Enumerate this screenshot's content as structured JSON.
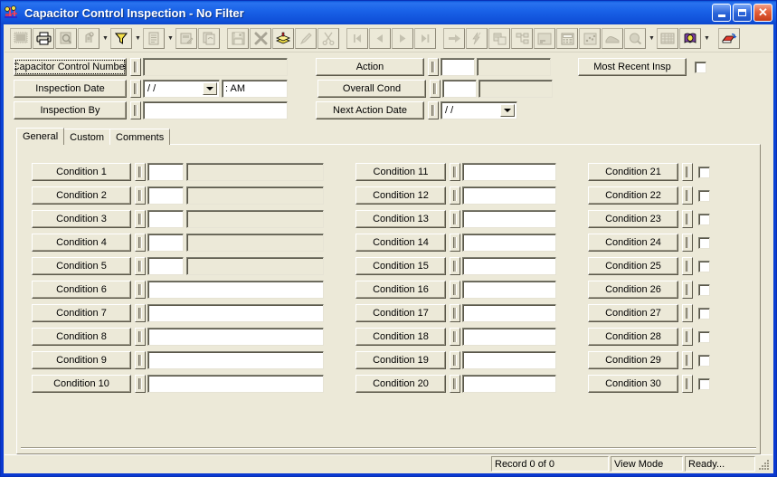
{
  "window": {
    "title": "Capacitor Control Inspection",
    "title_suffix": " - No Filter",
    "icon": "capacitor-app-icon",
    "minimize_label": "Minimize",
    "maximize_label": "Maximize",
    "close_label": "Close"
  },
  "toolbar": {
    "buttons": [
      {
        "name": "design-view-icon",
        "label": "Design View",
        "enabled": false
      },
      {
        "name": "print-icon",
        "label": "Print",
        "enabled": true
      },
      {
        "name": "print-preview-icon",
        "label": "Print Preview",
        "enabled": false
      },
      {
        "name": "find-icon",
        "label": "Find",
        "enabled": false,
        "dropdown": true
      },
      {
        "name": "filter-icon",
        "label": "Filter",
        "enabled": true,
        "dropdown": true
      },
      {
        "name": "new-record-icon",
        "label": "New Record",
        "enabled": false,
        "dropdown": true
      },
      {
        "name": "edit-record-icon",
        "label": "Edit Record",
        "enabled": false
      },
      {
        "name": "duplicate-record-icon",
        "label": "Duplicate Record",
        "enabled": false
      },
      {
        "name": "save-icon",
        "label": "Save",
        "enabled": false
      },
      {
        "name": "delete-icon",
        "label": "Delete",
        "enabled": true
      },
      {
        "name": "stack-icon",
        "label": "Batch",
        "enabled": true
      },
      {
        "name": "pencil-icon",
        "label": "Edit",
        "enabled": false
      },
      {
        "name": "cut-icon",
        "label": "Cut",
        "enabled": false
      },
      {
        "name": "first-record-icon",
        "label": "First Record",
        "enabled": false
      },
      {
        "name": "previous-record-icon",
        "label": "Previous Record",
        "enabled": false
      },
      {
        "name": "next-record-icon",
        "label": "Next Record",
        "enabled": false
      },
      {
        "name": "last-record-icon",
        "label": "Last Record",
        "enabled": false
      },
      {
        "name": "go-to-icon",
        "label": "Go To",
        "enabled": false
      },
      {
        "name": "lightning-icon",
        "label": "Quick Action",
        "enabled": false
      },
      {
        "name": "related-records-icon",
        "label": "Related Records",
        "enabled": false
      },
      {
        "name": "hierarchy-icon",
        "label": "Hierarchy",
        "enabled": false
      },
      {
        "name": "notes-icon",
        "label": "Notes",
        "enabled": false
      },
      {
        "name": "calculator-icon",
        "label": "Calculator",
        "enabled": false
      },
      {
        "name": "chart-icon",
        "label": "Chart",
        "enabled": false
      },
      {
        "name": "map-icon",
        "label": "Map",
        "enabled": false
      },
      {
        "name": "search-circle-icon",
        "label": "Lookup",
        "enabled": false,
        "dropdown": true
      },
      {
        "name": "grid-icon",
        "label": "Grid View",
        "enabled": false
      },
      {
        "name": "book-icon",
        "label": "Help Book",
        "enabled": true,
        "dropdown": true
      },
      {
        "name": "export-icon",
        "label": "Export",
        "enabled": true
      }
    ]
  },
  "header": {
    "left_fields": [
      {
        "label": "Capacitor Control Number",
        "value": "",
        "type": "text-disabled",
        "focused": true
      },
      {
        "label": "Inspection Date",
        "value": "/  /",
        "value2": ":    AM",
        "type": "date-time"
      },
      {
        "label": "Inspection By",
        "value": "",
        "type": "text"
      }
    ],
    "mid_fields": [
      {
        "label": "Action",
        "value": "",
        "value2": "",
        "type": "code-desc"
      },
      {
        "label": "Overall Cond",
        "value": "",
        "value2": "",
        "type": "code-desc"
      },
      {
        "label": "Next Action Date",
        "value": "/  /",
        "type": "date"
      }
    ],
    "right_fields": [
      {
        "label": "Most Recent Insp",
        "checked": false,
        "type": "checkbox"
      }
    ]
  },
  "tabs": [
    {
      "label": "General",
      "active": true
    },
    {
      "label": "Custom",
      "active": false
    },
    {
      "label": "Comments",
      "active": false
    }
  ],
  "conditions": {
    "column1": [
      {
        "label": "Condition 1",
        "code": "",
        "desc": "",
        "style": "code-desc"
      },
      {
        "label": "Condition 2",
        "code": "",
        "desc": "",
        "style": "code-desc"
      },
      {
        "label": "Condition 3",
        "code": "",
        "desc": "",
        "style": "code-desc"
      },
      {
        "label": "Condition 4",
        "code": "",
        "desc": "",
        "style": "code-desc"
      },
      {
        "label": "Condition 5",
        "code": "",
        "desc": "",
        "style": "code-desc"
      },
      {
        "label": "Condition 6",
        "value": "",
        "style": "wide"
      },
      {
        "label": "Condition 7",
        "value": "",
        "style": "wide"
      },
      {
        "label": "Condition 8",
        "value": "",
        "style": "wide"
      },
      {
        "label": "Condition 9",
        "value": "",
        "style": "wide"
      },
      {
        "label": "Condition 10",
        "value": "",
        "style": "wide"
      }
    ],
    "column2": [
      {
        "label": "Condition 11",
        "value": "",
        "style": "medium"
      },
      {
        "label": "Condition 12",
        "value": "",
        "style": "medium"
      },
      {
        "label": "Condition 13",
        "value": "",
        "style": "medium"
      },
      {
        "label": "Condition 14",
        "value": "",
        "style": "medium"
      },
      {
        "label": "Condition 15",
        "value": "",
        "style": "medium"
      },
      {
        "label": "Condition 16",
        "value": "",
        "style": "medium"
      },
      {
        "label": "Condition 17",
        "value": "",
        "style": "medium"
      },
      {
        "label": "Condition 18",
        "value": "",
        "style": "medium"
      },
      {
        "label": "Condition 19",
        "value": "",
        "style": "medium"
      },
      {
        "label": "Condition 20",
        "value": "",
        "style": "medium"
      }
    ],
    "column3": [
      {
        "label": "Condition 21",
        "checked": false,
        "style": "checkbox"
      },
      {
        "label": "Condition 22",
        "checked": false,
        "style": "checkbox"
      },
      {
        "label": "Condition 23",
        "checked": false,
        "style": "checkbox"
      },
      {
        "label": "Condition 24",
        "checked": false,
        "style": "checkbox"
      },
      {
        "label": "Condition 25",
        "checked": false,
        "style": "checkbox"
      },
      {
        "label": "Condition 26",
        "checked": false,
        "style": "checkbox"
      },
      {
        "label": "Condition 27",
        "checked": false,
        "style": "checkbox"
      },
      {
        "label": "Condition 28",
        "checked": false,
        "style": "checkbox"
      },
      {
        "label": "Condition 29",
        "checked": false,
        "style": "checkbox"
      },
      {
        "label": "Condition 30",
        "checked": false,
        "style": "checkbox"
      }
    ]
  },
  "statusbar": {
    "record": "Record 0 of 0",
    "mode": "View Mode",
    "state": "Ready..."
  },
  "colors": {
    "face": "#ece9d8",
    "title_blue": "#0a46d6",
    "close_red": "#c63d18",
    "field_white": "#ffffff"
  }
}
